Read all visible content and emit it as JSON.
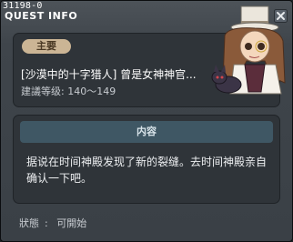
{
  "window": {
    "quest_id": "31198-0",
    "title": "QUEST INFO"
  },
  "quest": {
    "tag": "主要",
    "name": "[沙漠中的十字猎人] 曾是女神神官...",
    "level_label": "建議等级",
    "level_range": "140～149"
  },
  "content": {
    "header": "内容",
    "text": "据说在时间神殿发现了新的裂缝。去时间神殿亲自确认一下吧。"
  },
  "status": {
    "label": "狀態",
    "value": "可開始"
  },
  "icons": {
    "close": "close-icon",
    "npc": "npc-portrait"
  },
  "colors": {
    "tag_bg": "#cbb595",
    "header_bg": "#3f5764",
    "panel_bg": "#2f3439"
  }
}
